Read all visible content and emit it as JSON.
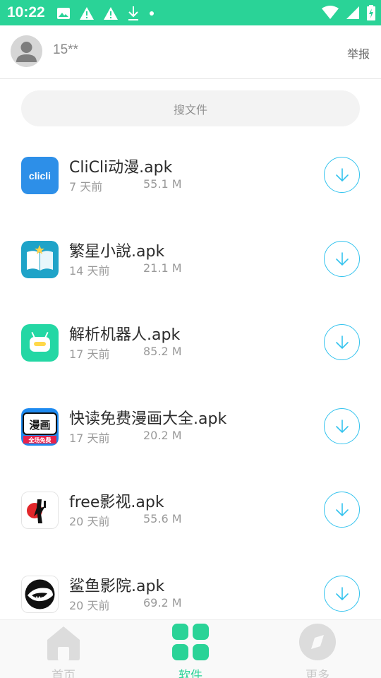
{
  "status_bar": {
    "time": "10:22",
    "icons": [
      "image-icon",
      "warning-icon",
      "warning-icon",
      "download-icon",
      "dot-icon",
      "wifi-icon",
      "signal-icon",
      "battery-icon"
    ]
  },
  "header": {
    "user_name": "15**",
    "report_label": "举报"
  },
  "search": {
    "placeholder": "搜文件"
  },
  "files": [
    {
      "name": "CliCli动漫.apk",
      "age": "7 天前",
      "size": "55.1 M",
      "icon": "clicli-app-icon"
    },
    {
      "name": "繁星小說.apk",
      "age": "14 天前",
      "size": "21.1 M",
      "icon": "book-app-icon"
    },
    {
      "name": "解析机器人.apk",
      "age": "17 天前",
      "size": "85.2 M",
      "icon": "robot-app-icon"
    },
    {
      "name": "快读免费漫画大全.apk",
      "age": "17 天前",
      "size": "20.2 M",
      "icon": "comic-app-icon"
    },
    {
      "name": "free影视.apk",
      "age": "20 天前",
      "size": "55.6 M",
      "icon": "free-video-app-icon"
    },
    {
      "name": "鲨鱼影院.apk",
      "age": "20 天前",
      "size": "69.2 M",
      "icon": "shark-app-icon"
    }
  ],
  "app_icon_text": {
    "clicli": "clicli",
    "comic_top": "漫画",
    "comic_bottom": "全场免费"
  },
  "nav": {
    "items": [
      {
        "label": "首页",
        "icon": "home-icon",
        "active": false
      },
      {
        "label": "软件",
        "icon": "grid-icon",
        "active": true
      },
      {
        "label": "更多",
        "icon": "compass-icon",
        "active": false
      }
    ]
  },
  "colors": {
    "accent": "#2ad397",
    "download_ring": "#33c3ee",
    "inactive_nav": "#c7c7c7"
  }
}
